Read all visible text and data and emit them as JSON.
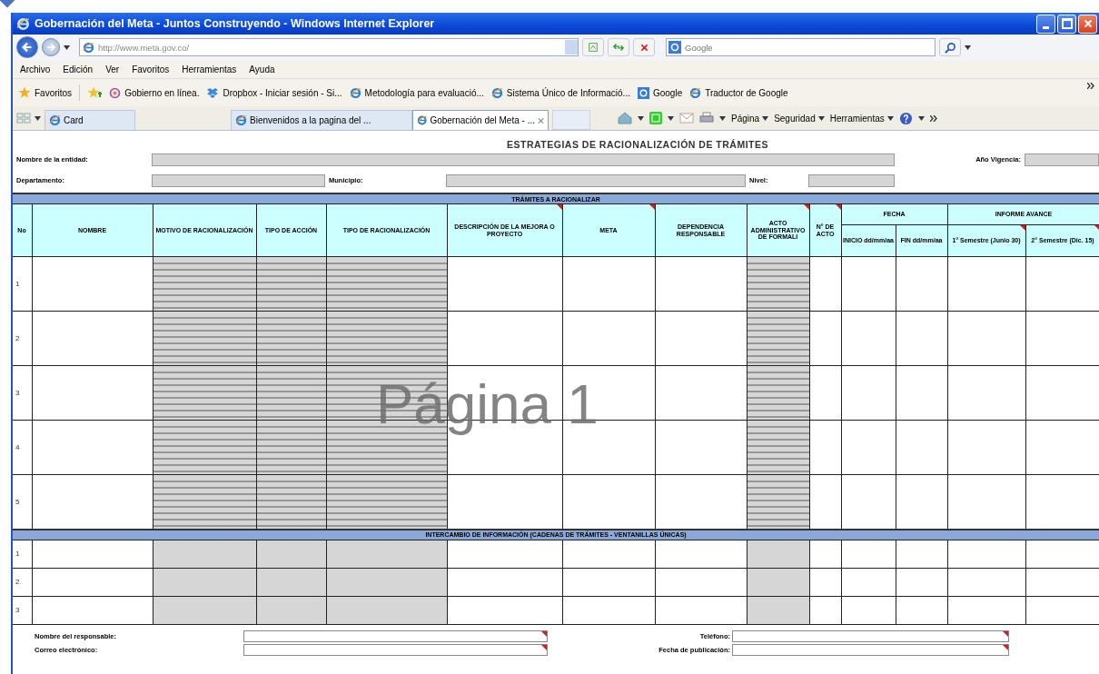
{
  "window": {
    "title": "Gobernación del Meta - Juntos Construyendo - Windows Internet Explorer"
  },
  "address_bar": {
    "value": "http://www.meta.gov.co/"
  },
  "search": {
    "placeholder": "Google"
  },
  "menu": [
    "Archivo",
    "Edición",
    "Ver",
    "Favoritos",
    "Herramientas",
    "Ayuda"
  ],
  "favorites": {
    "label": "Favoritos",
    "items": [
      {
        "label": "Gobierno en línea.",
        "kind": "site"
      },
      {
        "label": "Dropbox - Iniciar sesión - Si...",
        "kind": "box"
      },
      {
        "label": "Metodología para evaluació...",
        "kind": "ie"
      },
      {
        "label": "Sistema Único de Informació...",
        "kind": "ie"
      },
      {
        "label": "Google",
        "kind": "google"
      },
      {
        "label": "Traductor de Google",
        "kind": "ie"
      }
    ]
  },
  "tabs": [
    {
      "label": "Card",
      "selected": false
    },
    {
      "label": "Bienvenidos a la pagina del ...",
      "selected": false
    },
    {
      "label": "Gobernación del Meta - ...",
      "selected": true
    }
  ],
  "command_bar": [
    "Página",
    "Seguridad",
    "Herramientas"
  ],
  "sheet": {
    "title": "ESTRATEGIAS DE RACIONALIZACIÓN DE TRÁMITES",
    "form_rows": [
      [
        {
          "label": "Nombre de la entidad:"
        },
        {
          "label": "Año Vigencia:"
        }
      ],
      [
        {
          "label": "Departamento:"
        },
        {
          "label": "Municipio:"
        },
        {
          "label": "Nivel:"
        }
      ]
    ],
    "columns": [
      {
        "kind": "single",
        "label": "No",
        "note": false
      },
      {
        "kind": "single",
        "label": "NOMBRE",
        "shaded": false,
        "note": false
      },
      {
        "kind": "single",
        "label": "MOTIVO DE RACIONALIZACIÓN",
        "shaded": true,
        "note": false
      },
      {
        "kind": "single",
        "label": "TIPO DE ACCIÓN",
        "shaded": true,
        "note": false
      },
      {
        "kind": "single",
        "label": "TIPO DE RACIONALIZACIÓN",
        "shaded": true,
        "note": false
      },
      {
        "kind": "single",
        "label": "DESCRIPCIÓN DE LA MEJORA O PROYECTO",
        "shaded": false,
        "note": true
      },
      {
        "kind": "single",
        "label": "META",
        "shaded": false,
        "note": true
      },
      {
        "kind": "single",
        "label": "DEPENDENCIA RESPONSABLE",
        "shaded": false,
        "note": false
      },
      {
        "kind": "single",
        "label": "ACTO ADMINISTRATIVO DE FORMALI",
        "shaded": true,
        "note": true
      },
      {
        "kind": "single",
        "label": "N° DE ACTO",
        "shaded": false,
        "note": true
      },
      {
        "kind": "group",
        "label": "FECHA",
        "children": [
          {
            "label": "INICIO dd/mm/aa",
            "shaded": false,
            "note": false
          },
          {
            "label": "FIN dd/mm/aa",
            "shaded": false,
            "note": false
          }
        ]
      },
      {
        "kind": "group",
        "label": "INFORME AVANCE",
        "children": [
          {
            "label": "1° Semestre (Junio 30)",
            "shaded": false,
            "note": true
          },
          {
            "label": "2° Semestre (Dic. 15)",
            "shaded": false,
            "note": true
          }
        ]
      }
    ],
    "sections": [
      {
        "title": "TRÁMITES A RACIONALIZAR",
        "striped": true,
        "rows": [
          "1",
          "2",
          "3",
          "4",
          "5"
        ]
      },
      {
        "title": "INTERCAMBIO DE INFORMACIÓN (CADENAS DE TRÁMITES - VENTANILLAS ÚNICAS)",
        "striped": false,
        "rows": [
          "1",
          "2",
          "3"
        ]
      }
    ],
    "footer": [
      {
        "label": "Nombre del responsable:",
        "note": true
      },
      {
        "label": "Teléfono:",
        "note": true
      },
      {
        "label": "Correo electrónico:",
        "note": true
      },
      {
        "label": "Fecha de publicación:",
        "note": true
      }
    ],
    "page_label": "Página 1"
  }
}
